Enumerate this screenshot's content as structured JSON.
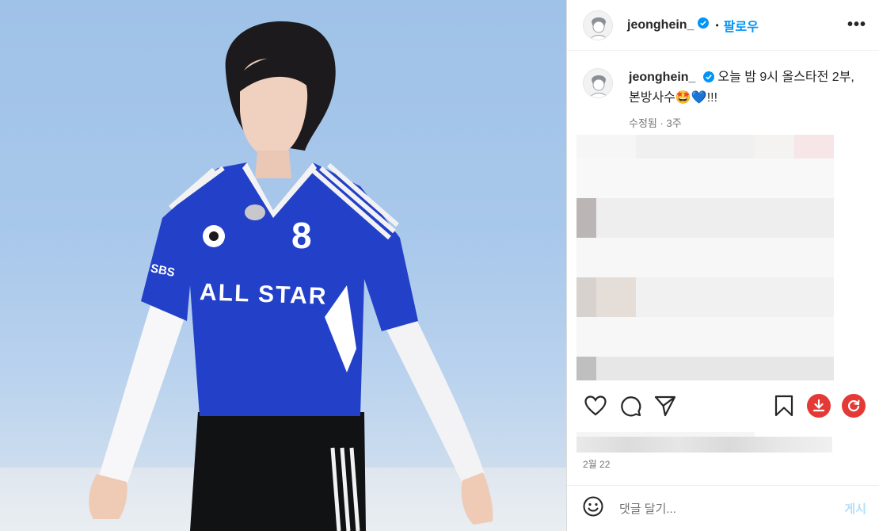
{
  "post": {
    "username": "jeonghein_",
    "follow_label": "팔로우",
    "more_label": "•••",
    "separator": "•",
    "caption": {
      "text": "오늘 밤 9시 올스타전 2부, 본방사수🤩💙!!!",
      "edited": "수정됨",
      "time_ago": "3주"
    },
    "date": "2월 22"
  },
  "photo": {
    "jersey_number": "8",
    "jersey_text": "ALL STAR",
    "sponsor_text": "SBS"
  },
  "comment": {
    "placeholder": "댓글 달기...",
    "post_label": "게시"
  },
  "colors": {
    "accent": "#0095f6",
    "post_button_disabled": "#b2dffc",
    "jersey_blue": "#2340c8",
    "download_red": "#e53935",
    "refresh_red": "#e53935"
  },
  "icons": [
    "heart-icon",
    "comment-icon",
    "share-icon",
    "bookmark-icon",
    "download-icon",
    "refresh-icon",
    "emoji-icon",
    "verified-icon"
  ]
}
